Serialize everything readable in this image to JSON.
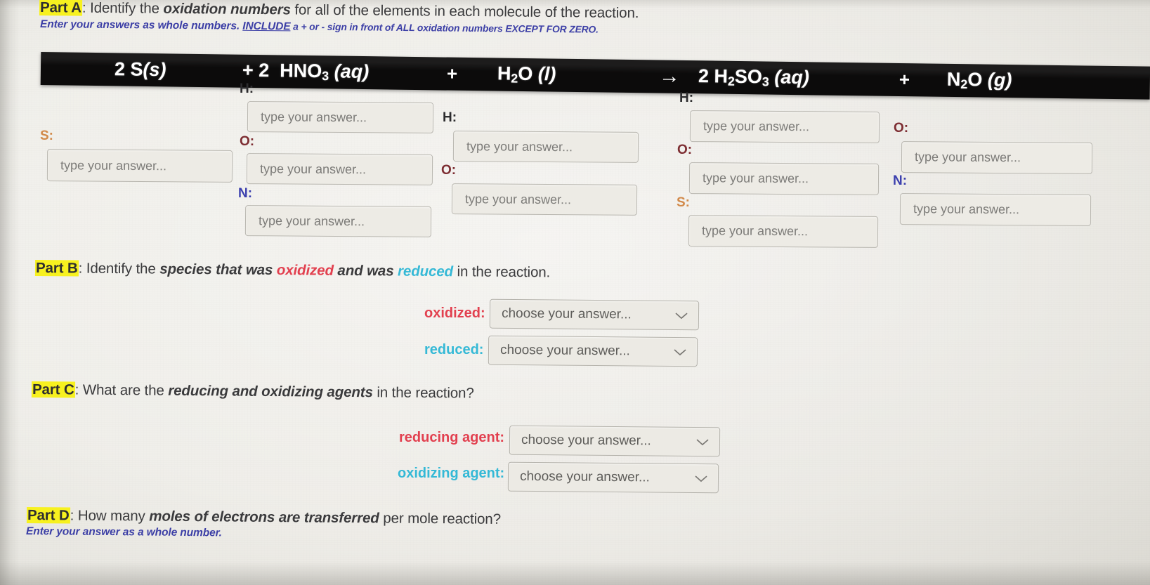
{
  "colors": {
    "highlight": "#f7f11f",
    "oxidized": "#e2404f",
    "reduced": "#35b9d6",
    "note_blue": "#3c3fa6",
    "label_O": "#7d2d32",
    "label_N": "#3b3fae",
    "label_S": "#d28a4a",
    "label_H": "#2c2c2e",
    "banner_bg": "#0c0b0b",
    "page_bg": "#eceae4"
  },
  "part_a": {
    "tag": "Part A",
    "colon": ":",
    "text_1": " Identify the ",
    "em_1": "oxidation numbers",
    "text_2": " for all of the elements in each molecule of the reaction.",
    "note_1": "Enter your answers as whole numbers. ",
    "note_underline": "INCLUDE",
    "note_2": " a + or - sign in front of ALL oxidation numbers EXCEPT FOR ZERO."
  },
  "equation": {
    "terms": [
      {
        "coef": "2",
        "formula": "S",
        "sub": "",
        "state": "(s)"
      },
      {
        "coef": "2",
        "formula": "HNO",
        "sub": "3",
        "state": "(aq)"
      },
      {
        "coef": "",
        "formula": "H",
        "sub": "2",
        "formula2": "O",
        "state": "(l)"
      },
      {
        "coef": "2",
        "formula": "H",
        "sub": "2",
        "formula2": "SO",
        "sub2": "3",
        "state": "(aq)"
      },
      {
        "coef": "",
        "formula": "N",
        "sub": "2",
        "formula2": "O",
        "state": "(g)"
      }
    ],
    "op_plus_1": "+",
    "op_plus_2": "+",
    "op_arrow": "→",
    "op_plus_3": "+",
    "display": {
      "t1": "2 S",
      "t1_state": "(s)",
      "t2_coef": "+ 2",
      "t2": "HNO",
      "t2_sub": "3",
      "t2_state": "(aq)",
      "t3_op": "+",
      "t3a": "H",
      "t3_sub": "2",
      "t3b": "O",
      "t3_state": "(l)",
      "t4_op": "→",
      "t4_coef": "2",
      "t4a": "H",
      "t4_sub": "2",
      "t4b": "SO",
      "t4_sub2": "3",
      "t4_state": "(aq)",
      "t5_op": "+",
      "t5a": "N",
      "t5_sub": "2",
      "t5b": "O",
      "t5_state": "(g)"
    }
  },
  "input_placeholder": "type your answer...",
  "molecule_inputs": [
    {
      "molecule": "2 S (s)",
      "fields": [
        {
          "label": "S:",
          "label_element": "S",
          "placeholder": "type your answer..."
        }
      ]
    },
    {
      "molecule": "2 HNO3 (aq)",
      "fields": [
        {
          "label": "H:",
          "label_element": "H",
          "placeholder": "type your answer..."
        },
        {
          "label": "O:",
          "label_element": "O",
          "placeholder": "type your answer..."
        },
        {
          "label": "N:",
          "label_element": "N",
          "placeholder": "type your answer..."
        }
      ]
    },
    {
      "molecule": "H2O (l)",
      "fields": [
        {
          "label": "H:",
          "label_element": "H",
          "placeholder": "type your answer..."
        },
        {
          "label": "O:",
          "label_element": "O",
          "placeholder": "type your answer..."
        }
      ]
    },
    {
      "molecule": "2 H2SO3 (aq)",
      "fields": [
        {
          "label": "H:",
          "label_element": "H",
          "placeholder": "type your answer..."
        },
        {
          "label": "O:",
          "label_element": "O",
          "placeholder": "type your answer..."
        },
        {
          "label": "S:",
          "label_element": "S",
          "placeholder": "type your answer..."
        }
      ]
    },
    {
      "molecule": "N2O (g)",
      "fields": [
        {
          "label": "O:",
          "label_element": "O",
          "placeholder": "type your answer..."
        },
        {
          "label": "N:",
          "label_element": "N",
          "placeholder": "type your answer..."
        }
      ]
    }
  ],
  "part_b": {
    "tag": "Part B",
    "colon": ":",
    "text_1": " Identify the ",
    "em_1": "species that was ",
    "ox_word": "oxidized",
    "em_2": " and was ",
    "red_word": "reduced",
    "text_2": " in the reaction.",
    "rows": [
      {
        "label": "oxidized:",
        "value": "choose your answer...",
        "icon": "chevron-down-icon"
      },
      {
        "label": "reduced:",
        "value": "choose your answer...",
        "icon": "chevron-down-icon"
      }
    ]
  },
  "part_c": {
    "tag": "Part C",
    "colon": ":",
    "text_1": " What are the ",
    "em_1": "reducing and oxidizing agents",
    "text_2": " in the reaction?",
    "rows": [
      {
        "label": "reducing agent:",
        "value": "choose your answer...",
        "icon": "chevron-down-icon"
      },
      {
        "label": "oxidizing agent:",
        "value": "choose your answer...",
        "icon": "chevron-down-icon"
      }
    ]
  },
  "part_d": {
    "tag": "Part D",
    "colon": ":",
    "text_1": " How many ",
    "em_1": "moles of electrons are transferred",
    "text_2": " per mole reaction?",
    "note": "Enter your answer as a whole number."
  }
}
